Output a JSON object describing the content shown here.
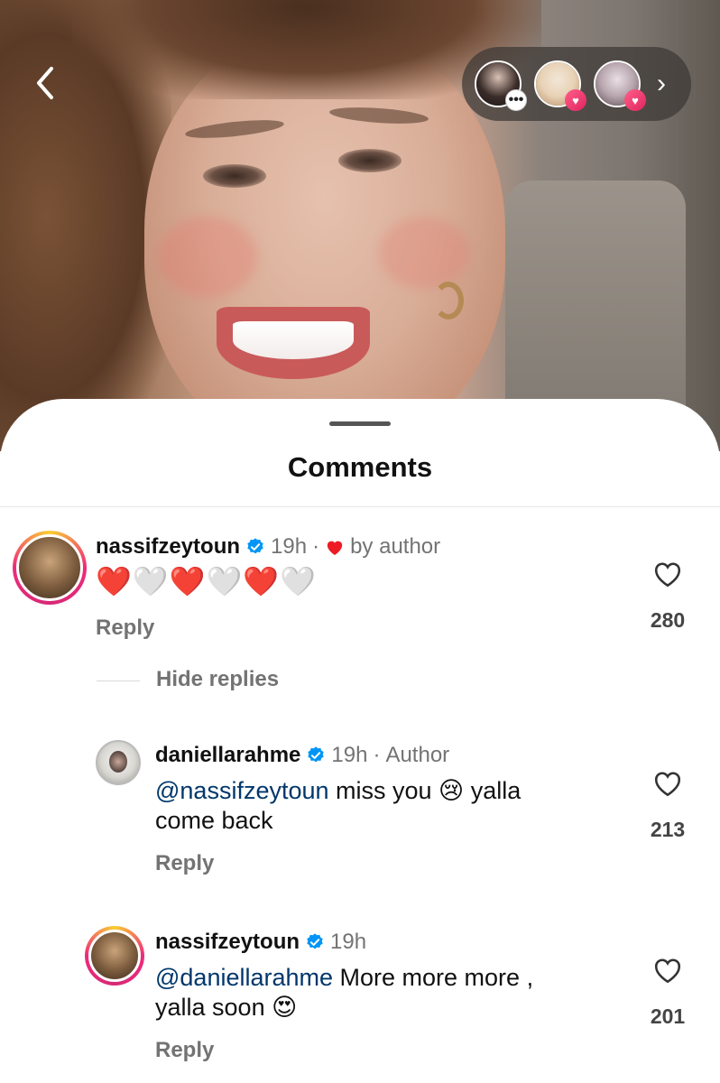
{
  "story": {
    "back_icon": "chevron-left-icon",
    "next_icon": "chevron-right-icon",
    "viewer_avatars": [
      {
        "icon": "chat-bubble-icon",
        "badge_glyph": "•••"
      },
      {
        "icon": "heart-icon",
        "badge_glyph": "♥"
      },
      {
        "icon": "heart-icon",
        "badge_glyph": "♥"
      }
    ]
  },
  "sheet": {
    "title": "Comments"
  },
  "comments": [
    {
      "username": "nassifzeytoun",
      "time": "19h",
      "separator": "·",
      "liked_by": "by author",
      "body": "❤️🤍❤️🤍❤️🤍",
      "reply": "Reply",
      "likes": "280"
    }
  ],
  "replies_toggle": "Hide replies",
  "replies": [
    {
      "username": "daniellarahme",
      "time": "19h",
      "separator": "·",
      "role": "Author",
      "mention": "@nassifzeytoun",
      "text_line1": " miss you 😢 yalla",
      "text_line2": "come back",
      "reply": "Reply",
      "likes": "213"
    },
    {
      "username": "nassifzeytoun",
      "time": "19h",
      "mention": "@daniellarahme",
      "text_line1": " More more more ,",
      "text_line2": "yalla soon 😍",
      "reply": "Reply",
      "likes": "201"
    }
  ],
  "colors": {
    "verified": "#0095f6",
    "mention": "#00376b",
    "meta": "#737373",
    "heart_red": "#ed1c24"
  }
}
